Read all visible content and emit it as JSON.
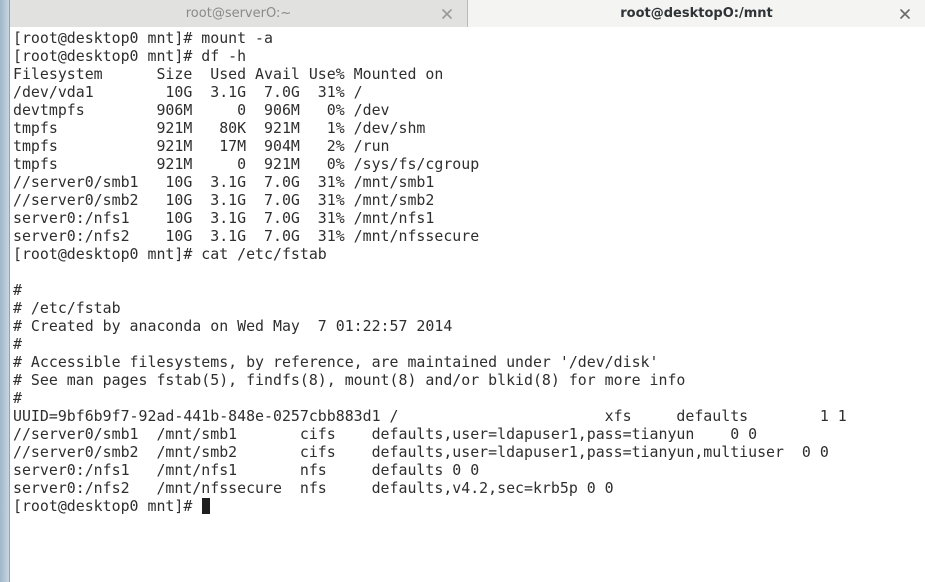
{
  "tabs": [
    {
      "label": "root@serverO:~",
      "state": "inactive"
    },
    {
      "label": "root@desktopO:/mnt",
      "state": "active"
    }
  ],
  "terminal": {
    "lines": [
      "[root@desktop0 mnt]# mount -a",
      "[root@desktop0 mnt]# df -h",
      "Filesystem      Size  Used Avail Use% Mounted on",
      "/dev/vda1        10G  3.1G  7.0G  31% /",
      "devtmpfs        906M     0  906M   0% /dev",
      "tmpfs           921M   80K  921M   1% /dev/shm",
      "tmpfs           921M   17M  904M   2% /run",
      "tmpfs           921M     0  921M   0% /sys/fs/cgroup",
      "//server0/smb1   10G  3.1G  7.0G  31% /mnt/smb1",
      "//server0/smb2   10G  3.1G  7.0G  31% /mnt/smb2",
      "server0:/nfs1    10G  3.1G  7.0G  31% /mnt/nfs1",
      "server0:/nfs2    10G  3.1G  7.0G  31% /mnt/nfssecure",
      "[root@desktop0 mnt]# cat /etc/fstab",
      "",
      "#",
      "# /etc/fstab",
      "# Created by anaconda on Wed May  7 01:22:57 2014",
      "#",
      "# Accessible filesystems, by reference, are maintained under '/dev/disk'",
      "# See man pages fstab(5), findfs(8), mount(8) and/or blkid(8) for more info",
      "#",
      "UUID=9bf6b9f7-92ad-441b-848e-0257cbb883d1 /                       xfs     defaults        1 1",
      "//server0/smb1  /mnt/smb1       cifs    defaults,user=ldapuser1,pass=tianyun    0 0",
      "//server0/smb2  /mnt/smb2       cifs    defaults,user=ldapuser1,pass=tianyun,multiuser  0 0",
      "server0:/nfs1   /mnt/nfs1       nfs     defaults 0 0",
      "server0:/nfs2   /mnt/nfssecure  nfs     defaults,v4.2,sec=krb5p 0 0"
    ],
    "prompt": "[root@desktop0 mnt]# "
  },
  "icons": {
    "tab_close": "close-icon",
    "cursor": "block-cursor"
  },
  "colors": {
    "text": "#2e2e2e",
    "background": "#ffffff",
    "tab_active_text": "#2e3436",
    "tab_inactive_text": "#8a8a87"
  }
}
